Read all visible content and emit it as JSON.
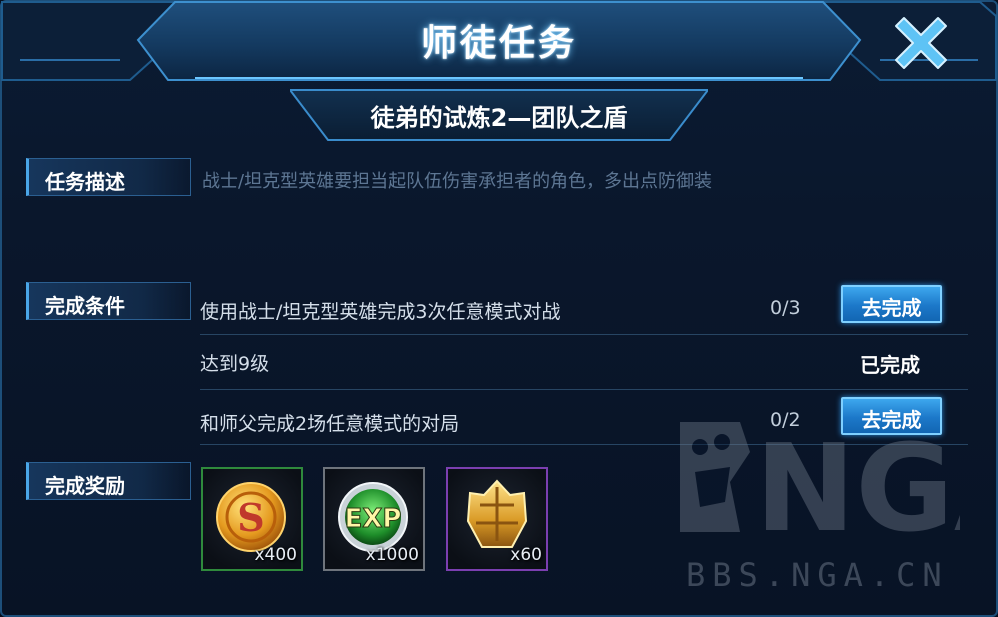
{
  "dialog": {
    "title": "师徒任务",
    "close_icon": "close-x-icon",
    "subtitle": "徒弟的试炼2—团队之盾"
  },
  "sections": {
    "description_label": "任务描述",
    "conditions_label": "完成条件",
    "rewards_label": "完成奖励"
  },
  "description": {
    "text": "战士/坦克型英雄要担当起队伍伤害承担者的角色，多出点防御装"
  },
  "conditions": [
    {
      "text": "使用战士/坦克型英雄完成3次任意模式对战",
      "progress": "0/3",
      "action": "去完成"
    },
    {
      "text": "达到9级",
      "status": "已完成"
    },
    {
      "text": "和师父完成2场任意模式的对局",
      "progress": "0/2",
      "action": "去完成"
    }
  ],
  "rewards": [
    {
      "icon": "gold-coin-icon",
      "count": "x400",
      "border": "#2f8a3c"
    },
    {
      "icon": "exp-icon",
      "count": "x1000",
      "border": "#6e747c"
    },
    {
      "icon": "crown-fragment-icon",
      "count": "x60",
      "border": "#7b3fb0"
    }
  ],
  "watermark": {
    "logo_text": "NGA",
    "url": "BBS.NGA.CN"
  }
}
